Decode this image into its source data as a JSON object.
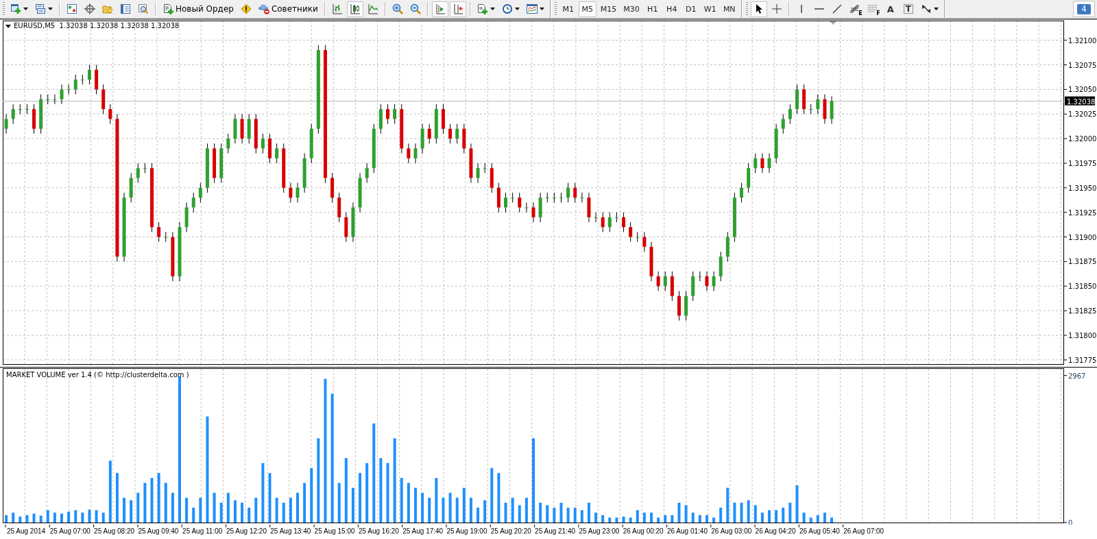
{
  "toolbar": {
    "new_order_button": "Новый Ордер",
    "experts_button": "Советники",
    "chart_type_buttons": [
      {
        "selected": false
      },
      {
        "selected": true
      },
      {
        "selected": false
      }
    ],
    "chart_shift_buttons": [
      {
        "selected": true
      },
      {
        "selected": true
      }
    ],
    "timeframes": [
      {
        "label": "M1",
        "selected": false
      },
      {
        "label": "M5",
        "selected": true
      },
      {
        "label": "M15",
        "selected": false
      },
      {
        "label": "M30",
        "selected": false
      },
      {
        "label": "H1",
        "selected": false
      },
      {
        "label": "H4",
        "selected": false
      },
      {
        "label": "D1",
        "selected": false
      },
      {
        "label": "W1",
        "selected": false
      },
      {
        "label": "MN",
        "selected": false
      }
    ],
    "cursor_buttons": [
      {
        "selected": true
      },
      {
        "selected": false
      }
    ],
    "tool_glyphs": {
      "fibo_expansion": "E",
      "fibo_fan": "F",
      "text_tool": "A",
      "text_label_tool": "T"
    },
    "notification_badge": "4"
  },
  "price_chart": {
    "header": "EURUSD,M5  1.32038 1.32038 1.32038 1.32038",
    "chart_data": {
      "type": "candlestick",
      "grid": true,
      "categories": [
        null,
        null,
        null,
        null,
        null,
        null,
        null,
        null,
        null,
        null,
        null,
        null,
        null,
        null,
        null,
        null,
        null,
        null,
        null,
        null,
        null,
        null,
        null,
        null,
        null,
        null,
        null,
        null,
        null,
        null,
        null,
        null,
        null,
        null,
        null,
        null,
        null,
        null,
        null,
        null,
        null,
        null,
        null,
        null,
        null,
        null,
        null,
        null,
        null,
        null,
        null,
        null,
        null,
        null,
        null,
        null,
        null,
        null,
        null,
        null,
        null,
        null,
        null,
        null,
        null,
        null,
        null,
        null,
        null,
        null,
        null,
        null,
        null,
        null,
        null,
        null,
        null,
        null,
        null,
        null,
        null,
        null,
        null,
        null,
        null,
        null,
        null,
        null,
        null,
        null,
        null,
        null,
        null,
        null,
        null,
        null,
        null,
        null,
        null,
        null,
        null,
        null,
        null,
        null,
        null,
        null,
        null,
        null,
        null,
        null,
        null,
        null,
        null,
        null,
        null,
        null,
        null,
        null,
        null,
        null,
        null,
        null,
        null,
        null,
        null,
        null,
        null,
        null,
        null,
        null,
        null,
        null,
        null,
        null,
        null,
        null,
        null,
        null,
        null,
        null,
        null,
        null,
        null,
        null,
        null,
        null,
        null,
        null,
        null,
        null,
        null,
        null,
        null
      ],
      "ohlc": [
        [
          1.3201,
          1.32025,
          1.32005,
          1.3202
        ],
        [
          1.3202,
          1.32035,
          1.32015,
          1.3203
        ],
        [
          1.3203,
          1.32035,
          1.32025,
          1.3203
        ],
        [
          1.3203,
          1.32035,
          1.32025,
          1.3203
        ],
        [
          1.3203,
          1.32035,
          1.32005,
          1.3201
        ],
        [
          1.3201,
          1.32045,
          1.32005,
          1.3204
        ],
        [
          1.3204,
          1.32045,
          1.32035,
          1.3204
        ],
        [
          1.3204,
          1.32045,
          1.32035,
          1.3204
        ],
        [
          1.3204,
          1.32055,
          1.32035,
          1.3205
        ],
        [
          1.3205,
          1.32055,
          1.32045,
          1.3205
        ],
        [
          1.3205,
          1.32065,
          1.32045,
          1.3206
        ],
        [
          1.3206,
          1.32065,
          1.32055,
          1.3206
        ],
        [
          1.3206,
          1.32075,
          1.32055,
          1.3207
        ],
        [
          1.3207,
          1.32075,
          1.32045,
          1.3205
        ],
        [
          1.3205,
          1.32055,
          1.32025,
          1.3203
        ],
        [
          1.3203,
          1.32035,
          1.32015,
          1.3202
        ],
        [
          1.3202,
          1.32025,
          1.31875,
          1.3188
        ],
        [
          1.3188,
          1.31945,
          1.31875,
          1.3194
        ],
        [
          1.3194,
          1.31965,
          1.31935,
          1.3196
        ],
        [
          1.3196,
          1.31975,
          1.31955,
          1.3197
        ],
        [
          1.3197,
          1.31975,
          1.31965,
          1.3197
        ],
        [
          1.3197,
          1.31975,
          1.31905,
          1.3191
        ],
        [
          1.3191,
          1.31915,
          1.31895,
          1.319
        ],
        [
          1.319,
          1.31905,
          1.31895,
          1.319
        ],
        [
          1.319,
          1.31905,
          1.31855,
          1.3186
        ],
        [
          1.3186,
          1.31915,
          1.31855,
          1.3191
        ],
        [
          1.3191,
          1.31935,
          1.31905,
          1.3193
        ],
        [
          1.3193,
          1.31945,
          1.31925,
          1.3194
        ],
        [
          1.3194,
          1.31955,
          1.31935,
          1.3195
        ],
        [
          1.3195,
          1.31995,
          1.31945,
          1.3199
        ],
        [
          1.3199,
          1.31995,
          1.31955,
          1.3196
        ],
        [
          1.3196,
          1.31995,
          1.31955,
          1.3199
        ],
        [
          1.3199,
          1.32005,
          1.31985,
          1.32
        ],
        [
          1.32,
          1.32025,
          1.31995,
          1.3202
        ],
        [
          1.3202,
          1.32025,
          1.31995,
          1.32
        ],
        [
          1.32,
          1.32025,
          1.31995,
          1.3202
        ],
        [
          1.3202,
          1.32025,
          1.31985,
          1.3199
        ],
        [
          1.3199,
          1.32005,
          1.31985,
          1.32
        ],
        [
          1.32,
          1.32005,
          1.31975,
          1.3198
        ],
        [
          1.3198,
          1.31995,
          1.31975,
          1.3199
        ],
        [
          1.3199,
          1.31995,
          1.31945,
          1.3195
        ],
        [
          1.3195,
          1.31955,
          1.31935,
          1.3194
        ],
        [
          1.3194,
          1.31955,
          1.31935,
          1.3195
        ],
        [
          1.3195,
          1.31985,
          1.31945,
          1.3198
        ],
        [
          1.3198,
          1.32015,
          1.31975,
          1.3201
        ],
        [
          1.3201,
          1.32095,
          1.32005,
          1.3209
        ],
        [
          1.3209,
          1.32095,
          1.31955,
          1.3196
        ],
        [
          1.3196,
          1.31965,
          1.31935,
          1.3194
        ],
        [
          1.3194,
          1.31945,
          1.31915,
          1.3192
        ],
        [
          1.3192,
          1.31925,
          1.31895,
          1.319
        ],
        [
          1.319,
          1.31935,
          1.31895,
          1.3193
        ],
        [
          1.3193,
          1.31965,
          1.31925,
          1.3196
        ],
        [
          1.3196,
          1.31975,
          1.31955,
          1.3197
        ],
        [
          1.3197,
          1.32015,
          1.31965,
          1.3201
        ],
        [
          1.3201,
          1.32035,
          1.32005,
          1.3203
        ],
        [
          1.3203,
          1.32035,
          1.32015,
          1.3202
        ],
        [
          1.3202,
          1.32035,
          1.32015,
          1.3203
        ],
        [
          1.3203,
          1.32035,
          1.31985,
          1.3199
        ],
        [
          1.3199,
          1.31995,
          1.31975,
          1.3198
        ],
        [
          1.3198,
          1.31995,
          1.31975,
          1.3199
        ],
        [
          1.3199,
          1.32015,
          1.31985,
          1.3201
        ],
        [
          1.3201,
          1.32015,
          1.31995,
          1.32
        ],
        [
          1.32,
          1.32035,
          1.31995,
          1.3203
        ],
        [
          1.3203,
          1.32035,
          1.32005,
          1.3201
        ],
        [
          1.3201,
          1.32015,
          1.31995,
          1.32
        ],
        [
          1.32,
          1.32015,
          1.31995,
          1.3201
        ],
        [
          1.3201,
          1.32015,
          1.31985,
          1.3199
        ],
        [
          1.3199,
          1.31995,
          1.31955,
          1.3196
        ],
        [
          1.3196,
          1.31975,
          1.31955,
          1.3197
        ],
        [
          1.3197,
          1.31975,
          1.31965,
          1.3197
        ],
        [
          1.3197,
          1.31975,
          1.31945,
          1.3195
        ],
        [
          1.3195,
          1.31955,
          1.31925,
          1.3193
        ],
        [
          1.3193,
          1.31945,
          1.31925,
          1.3194
        ],
        [
          1.3194,
          1.31945,
          1.31935,
          1.3194
        ],
        [
          1.3194,
          1.31945,
          1.31925,
          1.3193
        ],
        [
          1.3193,
          1.31935,
          1.31925,
          1.3193
        ],
        [
          1.3193,
          1.31935,
          1.31915,
          1.3192
        ],
        [
          1.3192,
          1.31945,
          1.31915,
          1.3194
        ],
        [
          1.3194,
          1.31945,
          1.31935,
          1.3194
        ],
        [
          1.3194,
          1.31945,
          1.31935,
          1.3194
        ],
        [
          1.3194,
          1.31945,
          1.31935,
          1.3194
        ],
        [
          1.3194,
          1.31955,
          1.31935,
          1.3195
        ],
        [
          1.3195,
          1.31955,
          1.31935,
          1.3194
        ],
        [
          1.3194,
          1.31945,
          1.31935,
          1.3194
        ],
        [
          1.3194,
          1.31945,
          1.31915,
          1.3192
        ],
        [
          1.3192,
          1.31925,
          1.31915,
          1.3192
        ],
        [
          1.3192,
          1.31925,
          1.31905,
          1.3191
        ],
        [
          1.3191,
          1.31925,
          1.31905,
          1.3192
        ],
        [
          1.3192,
          1.31925,
          1.31915,
          1.3192
        ],
        [
          1.3192,
          1.31925,
          1.31905,
          1.3191
        ],
        [
          1.3191,
          1.31915,
          1.31895,
          1.319
        ],
        [
          1.319,
          1.31905,
          1.31895,
          1.319
        ],
        [
          1.319,
          1.31905,
          1.31885,
          1.3189
        ],
        [
          1.3189,
          1.31895,
          1.31855,
          1.3186
        ],
        [
          1.3186,
          1.31865,
          1.31845,
          1.3185
        ],
        [
          1.3185,
          1.31865,
          1.31845,
          1.3186
        ],
        [
          1.3186,
          1.31865,
          1.31835,
          1.3184
        ],
        [
          1.3184,
          1.31845,
          1.31815,
          1.3182
        ],
        [
          1.3182,
          1.31845,
          1.31815,
          1.3184
        ],
        [
          1.3184,
          1.31865,
          1.31835,
          1.3186
        ],
        [
          1.3186,
          1.31865,
          1.31855,
          1.3186
        ],
        [
          1.3186,
          1.31865,
          1.31845,
          1.3185
        ],
        [
          1.3185,
          1.31865,
          1.31845,
          1.3186
        ],
        [
          1.3186,
          1.31885,
          1.31855,
          1.3188
        ],
        [
          1.3188,
          1.31905,
          1.31875,
          1.319
        ],
        [
          1.319,
          1.31945,
          1.31895,
          1.3194
        ],
        [
          1.3194,
          1.31955,
          1.31935,
          1.3195
        ],
        [
          1.3195,
          1.31975,
          1.31945,
          1.3197
        ],
        [
          1.3197,
          1.31985,
          1.31965,
          1.3198
        ],
        [
          1.3198,
          1.31985,
          1.31965,
          1.3197
        ],
        [
          1.3197,
          1.31985,
          1.31965,
          1.3198
        ],
        [
          1.3198,
          1.32015,
          1.31975,
          1.3201
        ],
        [
          1.3201,
          1.32025,
          1.32005,
          1.3202
        ],
        [
          1.3202,
          1.32035,
          1.32015,
          1.3203
        ],
        [
          1.3203,
          1.32055,
          1.32025,
          1.3205
        ],
        [
          1.3205,
          1.32055,
          1.32025,
          1.3203
        ],
        [
          1.3203,
          1.32035,
          1.32025,
          1.3203
        ],
        [
          1.3203,
          1.32045,
          1.32025,
          1.3204
        ],
        [
          1.3204,
          1.32045,
          1.32015,
          1.3202
        ],
        [
          1.3202,
          1.32043,
          1.32015,
          1.32038
        ],
        null,
        null,
        null,
        null,
        null,
        null,
        null,
        null,
        null,
        null,
        null,
        null,
        null,
        null,
        null,
        null,
        null,
        null,
        null,
        null,
        null,
        null,
        null,
        null,
        null,
        null,
        null,
        null,
        null,
        null,
        null,
        null,
        null
      ],
      "ylim": [
        1.3177,
        1.3212
      ],
      "yticks": [
        {
          "value": 1.321,
          "label": "1.32100"
        },
        {
          "value": 1.32075,
          "label": "1.32075"
        },
        {
          "value": 1.3205,
          "label": "1.32050"
        },
        {
          "value": 1.32025,
          "label": "1.32025"
        },
        {
          "value": 1.32,
          "label": "1.32000"
        },
        {
          "value": 1.31975,
          "label": "1.31975"
        },
        {
          "value": 1.3195,
          "label": "1.31950"
        },
        {
          "value": 1.31925,
          "label": "1.31925"
        },
        {
          "value": 1.319,
          "label": "1.31900"
        },
        {
          "value": 1.31875,
          "label": "1.31875"
        },
        {
          "value": 1.3185,
          "label": "1.31850"
        },
        {
          "value": 1.31825,
          "label": "1.31825"
        },
        {
          "value": 1.318,
          "label": "1.31800"
        },
        {
          "value": 1.31775,
          "label": "1.31775"
        }
      ],
      "ref_lines": [
        {
          "axis": "y",
          "value": 1.32038,
          "label": "1.32038"
        }
      ]
    }
  },
  "volume_chart": {
    "header": "MARKET VOLUME ver 1.4 (© http://clusterdelta.com )",
    "chart_data": {
      "type": "bar",
      "grid": true,
      "categories": [
        null,
        null,
        null,
        null,
        null,
        null,
        null,
        null,
        null,
        null,
        null,
        null,
        null,
        null,
        null,
        null,
        null,
        null,
        null,
        null,
        null,
        null,
        null,
        null,
        null,
        null,
        null,
        null,
        null,
        null,
        null,
        null,
        null,
        null,
        null,
        null,
        null,
        null,
        null,
        null,
        null,
        null,
        null,
        null,
        null,
        null,
        null,
        null,
        null,
        null,
        null,
        null,
        null,
        null,
        null,
        null,
        null,
        null,
        null,
        null,
        null,
        null,
        null,
        null,
        null,
        null,
        null,
        null,
        null,
        null,
        null,
        null,
        null,
        null,
        null,
        null,
        null,
        null,
        null,
        null,
        null,
        null,
        null,
        null,
        null,
        null,
        null,
        null,
        null,
        null,
        null,
        null,
        null,
        null,
        null,
        null,
        null,
        null,
        null,
        null,
        null,
        null,
        null,
        null,
        null,
        null,
        null,
        null,
        null,
        null,
        null,
        null,
        null,
        null,
        null,
        null,
        null,
        null,
        null,
        null,
        null,
        null,
        null,
        null,
        null,
        null,
        null,
        null,
        null,
        null,
        null,
        null,
        null,
        null,
        null,
        null,
        null,
        null,
        null,
        null,
        null,
        null,
        null,
        null,
        null,
        null,
        null,
        null,
        null,
        null,
        null,
        null,
        null
      ],
      "series": [
        {
          "color": "#1e90ff",
          "values": [
            150,
            200,
            120,
            150,
            180,
            140,
            250,
            200,
            180,
            220,
            250,
            200,
            260,
            250,
            200,
            1250,
            1000,
            500,
            450,
            600,
            800,
            900,
            1000,
            800,
            600,
            2950,
            500,
            300,
            500,
            2140,
            600,
            400,
            600,
            450,
            400,
            300,
            500,
            1200,
            1000,
            500,
            400,
            500,
            600,
            800,
            1100,
            1700,
            2900,
            2600,
            800,
            1300,
            700,
            1000,
            1200,
            2000,
            1300,
            1200,
            1700,
            900,
            800,
            700,
            600,
            500,
            900,
            500,
            600,
            500,
            700,
            500,
            300,
            450,
            1100,
            1000,
            400,
            500,
            350,
            500,
            1700,
            400,
            350,
            300,
            400,
            300,
            300,
            250,
            400,
            200,
            150,
            100,
            100,
            120,
            100,
            250,
            200,
            200,
            100,
            150,
            150,
            400,
            350,
            200,
            150,
            150,
            100,
            300,
            700,
            400,
            400,
            450,
            350,
            200,
            250,
            250,
            300,
            400,
            750,
            200,
            100,
            150,
            200,
            100,
            null,
            null,
            null,
            null,
            null,
            null,
            null,
            null,
            null,
            null,
            null,
            null,
            null,
            null,
            null,
            null,
            null,
            null,
            null,
            null,
            null,
            null,
            null,
            null,
            null,
            null,
            null,
            null,
            null,
            null,
            null,
            null,
            null
          ]
        }
      ],
      "ylim": [
        0,
        3100
      ],
      "yticks": [
        {
          "value": 2967,
          "label": "2967"
        },
        {
          "value": 0,
          "label": "0"
        }
      ]
    }
  },
  "time_axis": {
    "labels": [
      "25 Aug 2014",
      "25 Aug 07:00",
      "25 Aug 08:20",
      "25 Aug 09:40",
      "25 Aug 11:00",
      "25 Aug 12:20",
      "25 Aug 13:40",
      "25 Aug 15:00",
      "25 Aug 16:20",
      "25 Aug 17:40",
      "25 Aug 19:00",
      "25 Aug 20:20",
      "25 Aug 21:40",
      "25 Aug 23:00",
      "26 Aug 00:20",
      "26 Aug 01:40",
      "26 Aug 03:00",
      "26 Aug 04:20",
      "26 Aug 05:40",
      "26 Aug 07:00"
    ]
  }
}
